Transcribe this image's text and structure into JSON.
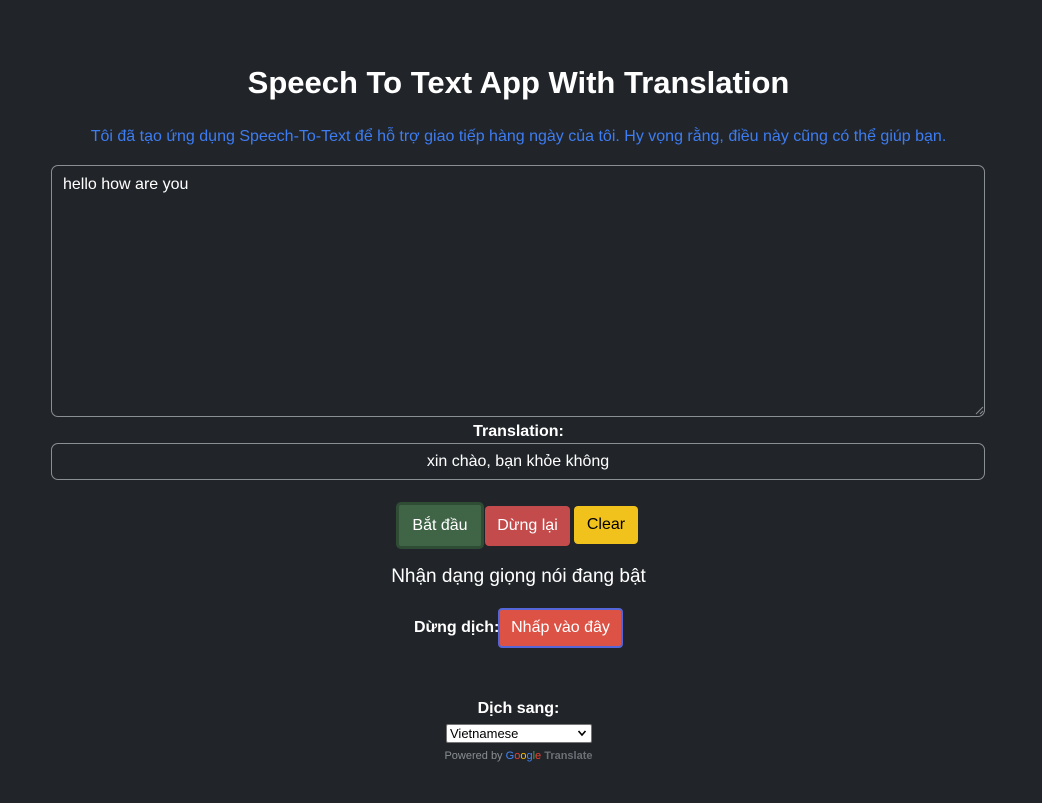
{
  "header": {
    "title": "Speech To Text App With Translation",
    "subtitle": "Tôi đã tạo ứng dụng Speech-To-Text để hỗ trợ giao tiếp hàng ngày của tôi. Hy vọng rằng, điều này cũng có thể giúp bạn."
  },
  "speech": {
    "text": "hello how are you"
  },
  "translation": {
    "label": "Translation:",
    "text": "xin chào, bạn khỏe không"
  },
  "controls": {
    "start_label": "Bắt đầu",
    "stop_label": "Dừng lại",
    "clear_label": "Clear"
  },
  "status": {
    "text": "Nhận dạng giọng nói đang bật"
  },
  "stop_translate": {
    "label": "Dừng dịch:",
    "button_label": "Nhấp vào đây"
  },
  "target_language": {
    "label": "Dịch sang:",
    "selected": "Vietnamese"
  },
  "powered_by": {
    "prefix": "Powered by",
    "google": [
      "G",
      "o",
      "o",
      "g",
      "l",
      "e"
    ],
    "product": "Translate"
  },
  "colors": {
    "background": "#212529",
    "accent_text": "#3d7cf2",
    "start_button": "#406446",
    "stop_button": "#c44b4b",
    "clear_button": "#f1c21b",
    "click_here_button": "#dc5346"
  },
  "icons": {
    "select_chevron": "chevron-down-icon",
    "textarea_resize": "resize-grip-icon"
  }
}
